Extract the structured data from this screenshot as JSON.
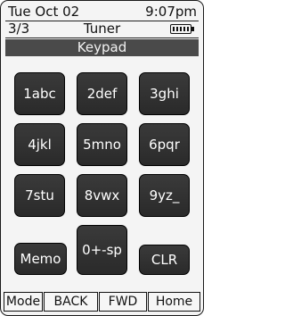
{
  "status": {
    "date": "Tue Oct 02",
    "time": "9:07pm",
    "page": "3/3",
    "source": "Tuner",
    "battery_icon": "battery-icon"
  },
  "header": {
    "title": "Keypad"
  },
  "keys": [
    "1abc",
    "2def",
    "3ghi",
    "4jkl",
    "5mno",
    "6pqr",
    "7stu",
    "8vwx",
    "9yz_",
    "Memo",
    "0+-sp",
    "CLR"
  ],
  "softkeys": {
    "mode": "Mode",
    "back": "BACK",
    "fwd": "FWD",
    "home": "Home"
  }
}
